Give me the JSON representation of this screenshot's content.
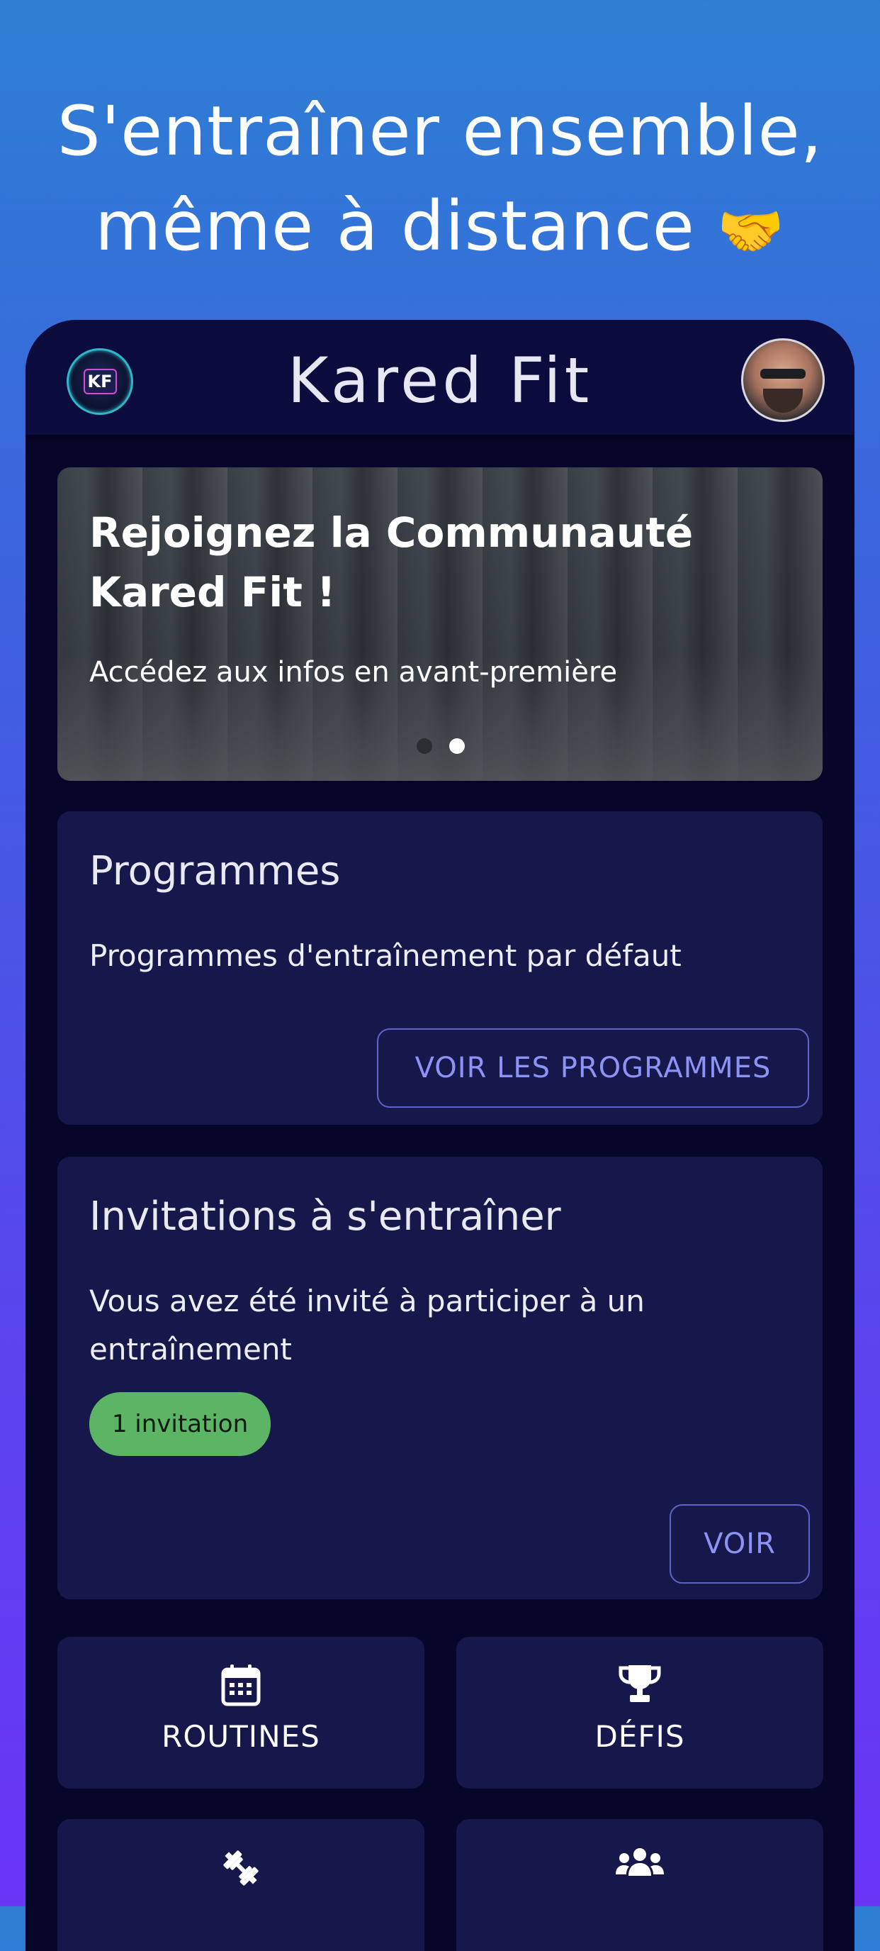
{
  "promo": {
    "line1": "S'entraîner ensemble,",
    "line2": "même à distance",
    "emoji": "🤝"
  },
  "appbar": {
    "logo_text": "KF",
    "title": "Kared Fit"
  },
  "banner": {
    "title": "Rejoignez la Communauté Kared Fit !",
    "subtitle": "Accédez aux infos en avant-première",
    "slides": 2,
    "active_slide": 2
  },
  "programmes": {
    "title": "Programmes",
    "description": "Programmes d'entraînement par défaut",
    "button": "VOIR LES PROGRAMMES"
  },
  "invitations": {
    "title": "Invitations à s'entraîner",
    "description": "Vous avez été invité à participer à un entraînement",
    "badge": "1 invitation",
    "button": "VOIR"
  },
  "tiles": [
    {
      "label": "ROUTINES",
      "icon": "calendar-icon"
    },
    {
      "label": "DÉFIS",
      "icon": "trophy-icon"
    },
    {
      "label": "",
      "icon": "dumbbell-icon"
    },
    {
      "label": "",
      "icon": "group-icon"
    }
  ],
  "colors": {
    "background_top": "#2d7fd4",
    "background_bottom": "#6a34f6",
    "app_background": "#05062a",
    "card_background": "#16174a",
    "accent": "#8d92f5",
    "badge_green": "#5cb564"
  }
}
